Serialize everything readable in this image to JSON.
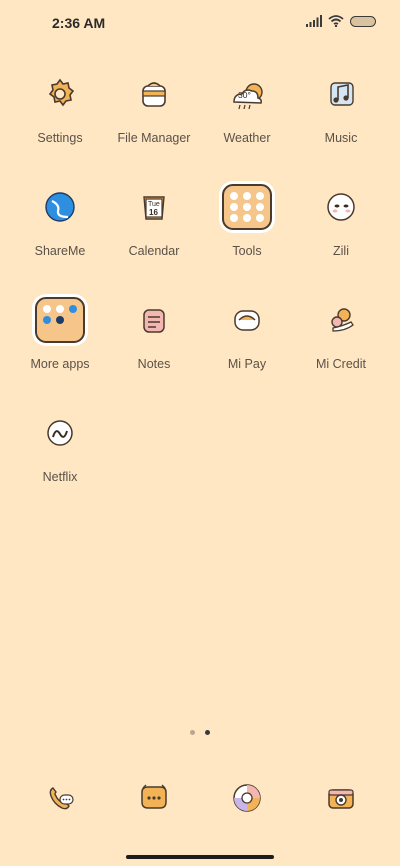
{
  "status_bar": {
    "time": "2:36 AM"
  },
  "apps": [
    {
      "id": "settings",
      "label": "Settings",
      "icon": "settings-icon"
    },
    {
      "id": "file-manager",
      "label": "File Manager",
      "icon": "file-manager-icon"
    },
    {
      "id": "weather",
      "label": "Weather",
      "icon": "weather-icon",
      "badge": "30°"
    },
    {
      "id": "music",
      "label": "Music",
      "icon": "music-icon"
    },
    {
      "id": "shareme",
      "label": "ShareMe",
      "icon": "shareme-icon"
    },
    {
      "id": "calendar",
      "label": "Calendar",
      "icon": "calendar-icon",
      "day": "Tue",
      "date": "16"
    },
    {
      "id": "tools",
      "label": "Tools",
      "icon": "tools-folder-icon"
    },
    {
      "id": "zili",
      "label": "Zili",
      "icon": "zili-icon"
    },
    {
      "id": "more-apps",
      "label": "More apps",
      "icon": "more-apps-folder-icon"
    },
    {
      "id": "notes",
      "label": "Notes",
      "icon": "notes-icon"
    },
    {
      "id": "mi-pay",
      "label": "Mi Pay",
      "icon": "mi-pay-icon"
    },
    {
      "id": "mi-credit",
      "label": "Mi Credit",
      "icon": "mi-credit-icon"
    },
    {
      "id": "netflix",
      "label": "Netflix",
      "icon": "netflix-icon"
    }
  ],
  "dock": [
    {
      "id": "phone",
      "icon": "phone-icon"
    },
    {
      "id": "messages",
      "icon": "messages-icon"
    },
    {
      "id": "browser",
      "icon": "browser-icon"
    },
    {
      "id": "camera",
      "icon": "camera-icon"
    }
  ],
  "page_indicator": {
    "pages": 2,
    "active": 2
  },
  "colors": {
    "background": "#FFE7C4",
    "label": "#5b5148",
    "accent": "#F5C58A"
  }
}
